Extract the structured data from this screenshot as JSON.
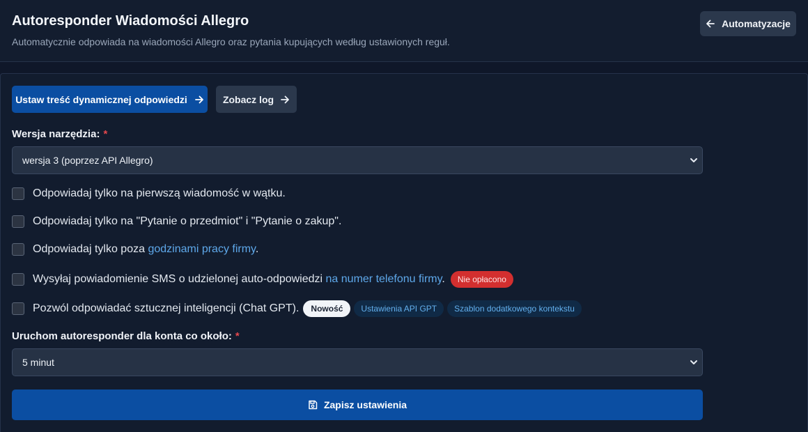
{
  "header": {
    "title": "Autoresponder Wiadomości Allegro",
    "subtitle": "Automatycznie odpowiada na wiadomości Allegro oraz pytania kupujących według ustawionych reguł.",
    "back_label": "Automatyzacje"
  },
  "actions": {
    "dynamic_label": "Ustaw treść dynamicznej odpowiedzi",
    "log_label": "Zobacz log"
  },
  "tool_version": {
    "label": "Wersja narzędzia:",
    "required_mark": "*",
    "selected": "wersja 3 (poprzez API Allegro)"
  },
  "options": {
    "first_message": "Odpowiadaj tylko na pierwszą wiadomość w wątku.",
    "question_types": "Odpowiadaj tylko na \"Pytanie o przedmiot\" i \"Pytanie o zakup\".",
    "outside_hours_prefix": "Odpowiadaj tylko poza ",
    "outside_hours_link": "godzinami pracy firmy",
    "outside_hours_suffix": ".",
    "sms_prefix": "Wysyłaj powiadomienie SMS o udzielonej auto-odpowiedzi ",
    "sms_link": "na numer telefonu firmy",
    "sms_suffix": ".",
    "sms_badge": "Nie opłacono",
    "ai_text": "Pozwól odpowiadać sztucznej inteligencji (Chat GPT).",
    "ai_badge_new": "Nowość",
    "ai_badge_api": "Ustawienia API GPT",
    "ai_badge_template": "Szablon dodatkowego kontekstu"
  },
  "interval": {
    "label": "Uruchom autoresponder dla konta co około:",
    "required_mark": "*",
    "selected": "5 minut"
  },
  "save_label": "Zapisz ustawienia",
  "colors": {
    "accent": "#0b4ea2",
    "link": "#5ea8ea",
    "danger": "#d32f2f",
    "background": "#0f1729"
  },
  "icons": {
    "back": "arrow-left-icon",
    "forward": "arrow-right-icon",
    "select": "chevron-down-icon",
    "save": "floppy-disk-icon"
  }
}
